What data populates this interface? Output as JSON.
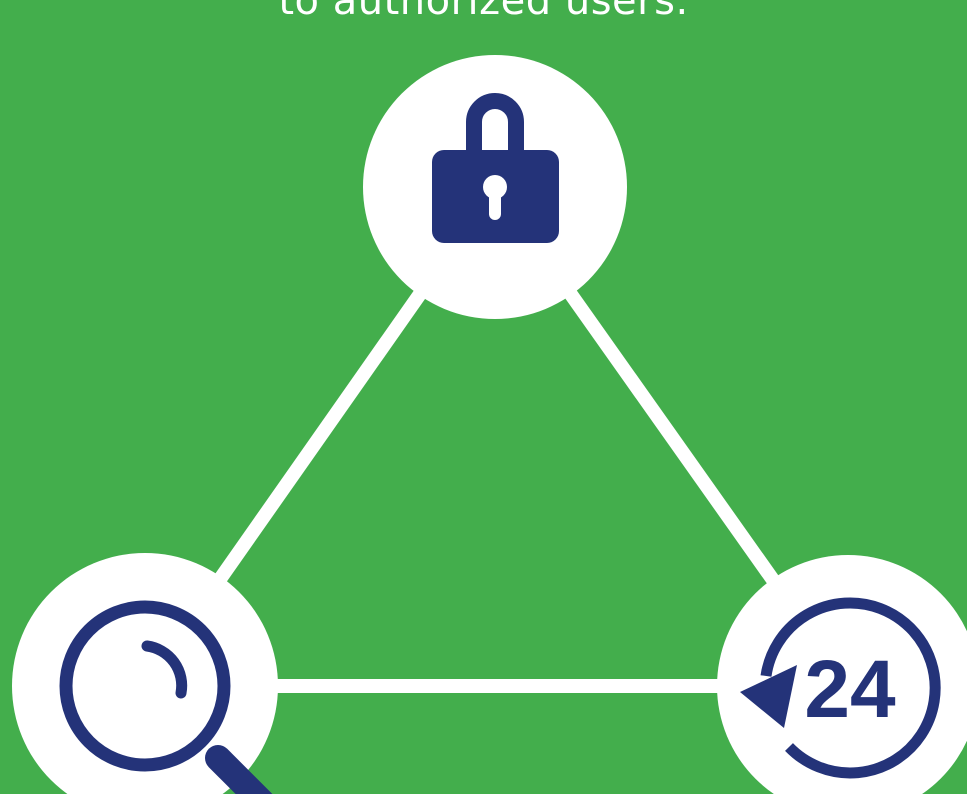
{
  "caption": "to authorized users.",
  "colors": {
    "background": "#43ae4c",
    "node_fill": "#ffffff",
    "connector": "#ffffff",
    "icon": "#243379"
  },
  "nodes": [
    {
      "id": "top",
      "icon": "padlock-icon",
      "label": ""
    },
    {
      "id": "bottom-left",
      "icon": "magnifying-glass-icon",
      "label": ""
    },
    {
      "id": "bottom-right",
      "icon": "24-hour-availability-icon",
      "label": "24"
    }
  ]
}
